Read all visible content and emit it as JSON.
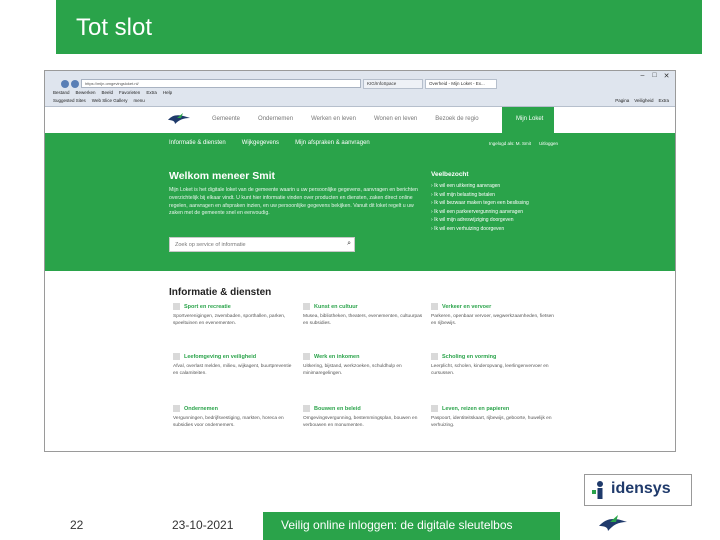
{
  "slide": {
    "title": "Tot slot",
    "page_number": "22",
    "date": "23-10-2021",
    "footer_text": "Veilig online inloggen: de digitale sleutelbos",
    "logo_text": "idensys"
  },
  "browser": {
    "address": "https://mijn.omgevingsloket.nl/",
    "tabs": [
      "KIG/InfoSpace",
      "Overheid - Mijn Loket - Ex..."
    ],
    "menu": [
      "Bestand",
      "Bewerken",
      "Beeld",
      "Favorieten",
      "Extra",
      "Help"
    ],
    "favorites": [
      "Suggested Sites",
      "Web Slice Gallery",
      "menu"
    ],
    "tools": [
      "Pagina",
      "Veiligheid",
      "Extra"
    ]
  },
  "site": {
    "topnav": [
      "Gemeente",
      "Ondernemen",
      "Werken en leven",
      "Wonen en leven",
      "Bezoek de regio"
    ],
    "mijn_loket": "Mijn Loket",
    "subnav": [
      "Informatie & diensten",
      "Wijkgegevens",
      "Mijn afspraken & aanvragen"
    ],
    "subnav_right": [
      "Ingelogd als: M. Smit",
      "Uitloggen"
    ],
    "welcome_title": "Welkom meneer Smit",
    "welcome_body": "Mijn Loket is het digitale loket van de gemeente waarin u uw persoonlijke gegevens, aanvragen en berichten overzichtelijk bij elkaar vindt. U kunt hier informatie vinden over producten en diensten, zaken direct online regelen, aanvragen en afspraken inzien, en uw persoonlijke gegevens bekijken. Vanuit dit loket regelt u uw zaken met de gemeente snel en eenvoudig.",
    "search_placeholder": "Zoek op service of informatie",
    "veelbezocht_title": "Veelbezocht",
    "veelbezocht": [
      "Ik wil een uitkering aanvragen",
      "Ik wil mijn belasting betalen",
      "Ik wil bezwaar maken tegen een beslissing",
      "Ik wil een parkeervergunning aanvragen",
      "Ik wil mijn adreswijziging doorgeven",
      "Ik wil een verhuizing doorgeven"
    ],
    "info_title": "Informatie & diensten",
    "categories": [
      {
        "title": "Sport en recreatie",
        "text": "Sportverenigingen, zwembaden, sporthallen, parken, speeltuinen en evenementen."
      },
      {
        "title": "Kunst en cultuur",
        "text": "Musea, bibliotheken, theaters, evenementen, cultuurpas en subsidies."
      },
      {
        "title": "Verkeer en vervoer",
        "text": "Parkeren, openbaar vervoer, wegwerkzaamheden, fietsen en rijbewijs."
      },
      {
        "title": "Leefomgeving en veiligheid",
        "text": "Afval, overlast melden, milieu, wijkagent, buurtpreventie en calamiteiten."
      },
      {
        "title": "Werk en inkomen",
        "text": "Uitkering, bijstand, werkzoeken, schuldhulp en minimaregelingen."
      },
      {
        "title": "Scholing en vorming",
        "text": "Leerplicht, scholen, kinderopvang, leerlingenvervoer en cursussen."
      },
      {
        "title": "Ondernemen",
        "text": "Vergunningen, bedrijfsvestiging, markten, horeca en subsidies voor ondernemers."
      },
      {
        "title": "Bouwen en beleid",
        "text": "Omgevingsvergunning, bestemmingsplan, bouwen en verbouwen en monumenten."
      },
      {
        "title": "Leven, reizen en papieren",
        "text": "Paspoort, identiteitskaart, rijbewijs, geboorte, huwelijk en verhuizing."
      }
    ]
  },
  "colors": {
    "accent": "#2aa34a",
    "navy": "#1f3a6b"
  }
}
